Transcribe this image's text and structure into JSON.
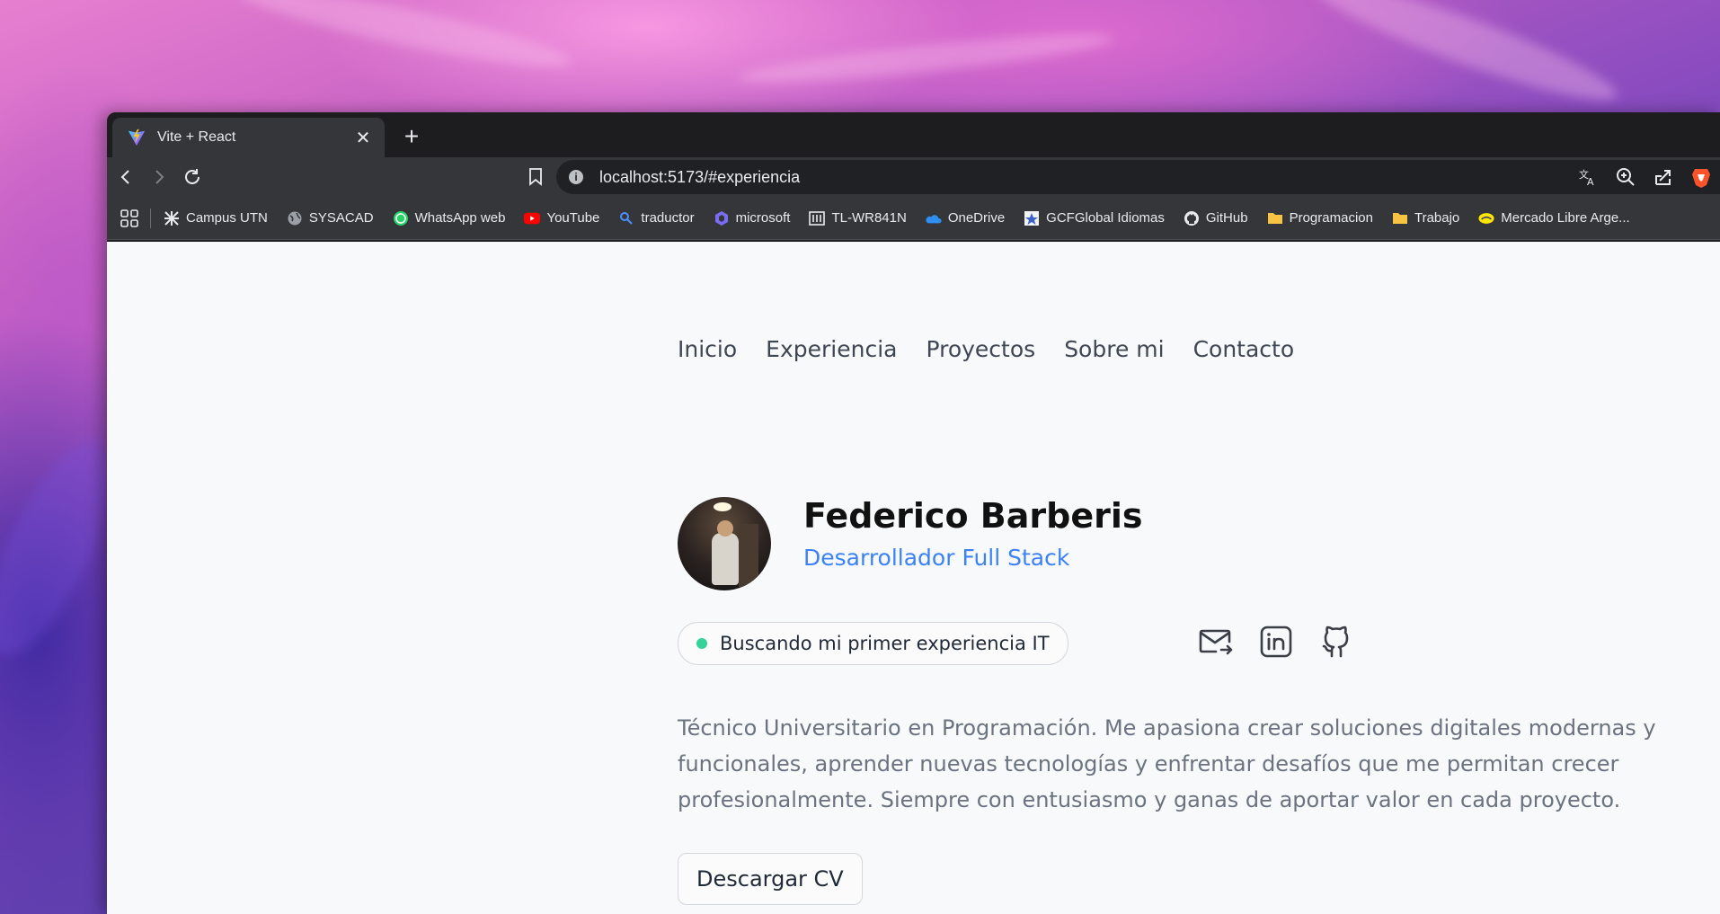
{
  "browser": {
    "tab_title": "Vite + React",
    "url": "localhost:5173/#experiencia",
    "bookmarks": [
      {
        "label": "Campus UTN",
        "icon": "campus-icon"
      },
      {
        "label": "SYSACAD",
        "icon": "globe-icon"
      },
      {
        "label": "WhatsApp web",
        "icon": "whatsapp-icon"
      },
      {
        "label": "YouTube",
        "icon": "youtube-icon"
      },
      {
        "label": "traductor",
        "icon": "search-icon"
      },
      {
        "label": "microsoft",
        "icon": "copilot-icon"
      },
      {
        "label": "TL-WR841N",
        "icon": "router-icon"
      },
      {
        "label": "OneDrive",
        "icon": "onedrive-icon"
      },
      {
        "label": "GCFGlobal Idiomas",
        "icon": "gcf-icon"
      },
      {
        "label": "GitHub",
        "icon": "github-icon"
      },
      {
        "label": "Programacion",
        "icon": "folder-icon"
      },
      {
        "label": "Trabajo",
        "icon": "folder-icon"
      },
      {
        "label": "Mercado Libre Arge...",
        "icon": "mercadolibre-icon"
      }
    ]
  },
  "page": {
    "nav": [
      "Inicio",
      "Experiencia",
      "Proyectos",
      "Sobre mi",
      "Contacto"
    ],
    "name": "Federico Barberis",
    "role": "Desarrollador Full Stack",
    "status": "Buscando mi primer experiencia IT",
    "bio": "Técnico Universitario en Programación. Me apasiona crear soluciones digitales modernas y funcionales, aprender nuevas tecnologías y enfrentar desafíos que me permitan crecer profesionalmente. Siempre con entusiasmo y ganas de aportar valor en cada proyecto.",
    "cv_button": "Descargar CV",
    "social_icons": [
      "mail-icon",
      "linkedin-icon",
      "github-icon"
    ]
  },
  "colors": {
    "accent": "#3b82f6",
    "status_dot": "#34d399",
    "page_bg": "#f8f9fa"
  }
}
